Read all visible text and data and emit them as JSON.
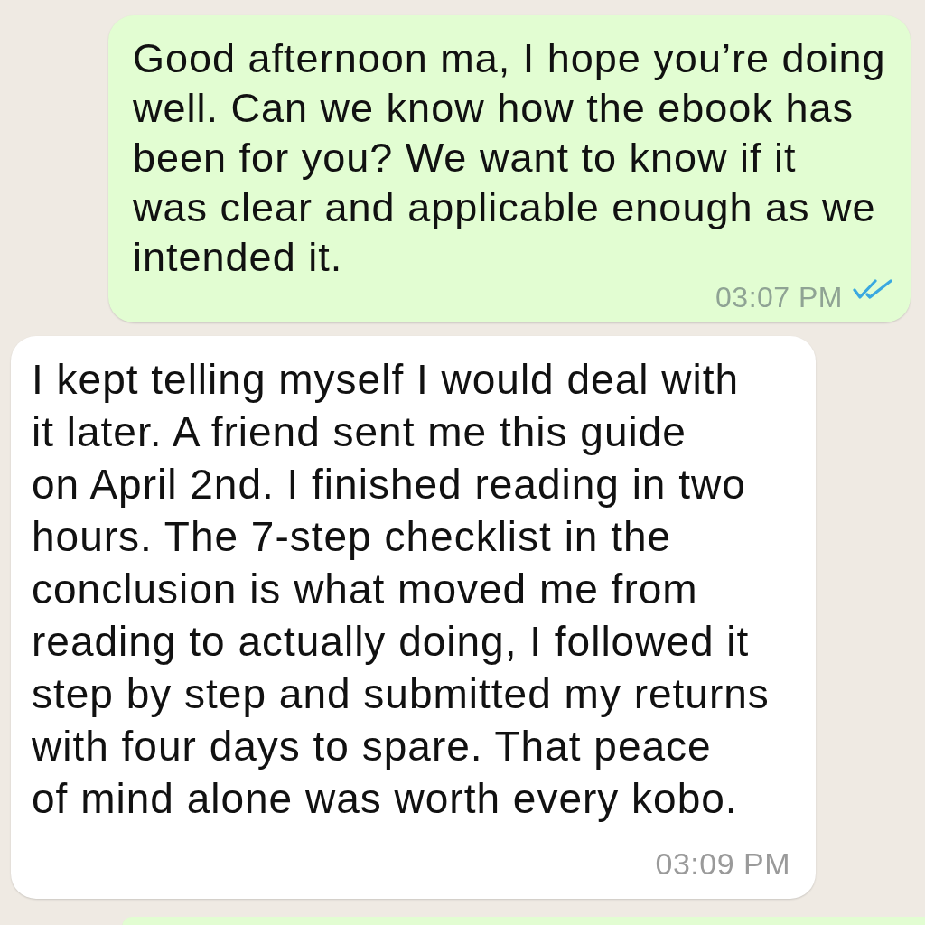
{
  "messages": [
    {
      "kind": "outgoing",
      "lines": [
        "Good afternoon ma, I hope you’re doing",
        "well. Can we know how the ebook has",
        "been for you? We want to know if it",
        "was clear and applicable enough as we",
        "intended it."
      ],
      "time": "03:07 PM",
      "read": true
    },
    {
      "kind": "incoming",
      "lines": [
        "I kept telling myself I would deal with",
        "it later. A friend sent me this guide",
        "on April 2nd. I finished reading in two",
        "hours. The 7-step checklist in the",
        "conclusion is what moved me from",
        "reading to actually doing, I followed it",
        "step by step and submitted my returns",
        "with four days to spare. That peace",
        "of mind alone was worth every kobo."
      ],
      "time": "03:09 PM"
    },
    {
      "kind": "outgoing"
    }
  ]
}
